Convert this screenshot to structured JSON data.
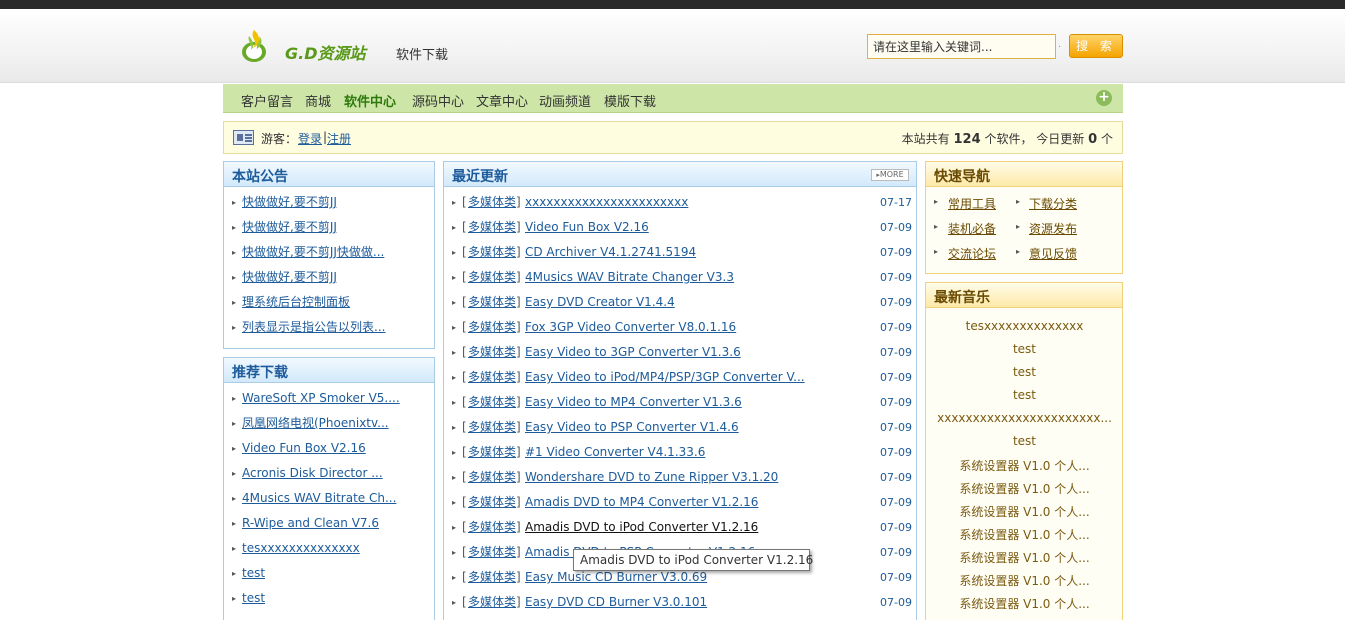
{
  "header": {
    "logo_text": "G.D资源站",
    "logo_sub": "软件下载",
    "search_placeholder": "请在这里输入关键词...",
    "search_button": "搜 索",
    "search_dot": "·"
  },
  "nav": {
    "items": [
      "客户留言",
      "商城",
      "软件中心",
      "源码中心",
      "文章中心",
      "动画频道",
      "模版下载"
    ],
    "active": "软件中心",
    "plus": "+"
  },
  "infobar": {
    "guest_label": "游客：",
    "login": "登录",
    "separator": "|",
    "register": "注册",
    "stats_prefix": "本站共有",
    "software_count": "124",
    "stats_mid": "个软件，  今日更新",
    "today_count": "0",
    "stats_suffix": "个"
  },
  "announcements": {
    "title": "本站公告",
    "items": [
      "快做做好,要不剪JJ",
      "快做做好,要不剪JJ",
      "快做做好,要不剪JJ快做做...",
      "快做做好,要不剪JJ",
      "理系统后台控制面板",
      "列表显示是指公告以列表..."
    ]
  },
  "recommended": {
    "title": "推荐下载",
    "items": [
      "WareSoft XP Smoker V5....",
      "凤凰网络电视(Phoenixtv...",
      "Video Fun Box V2.16",
      "Acronis Disk Director ...",
      "4Musics WAV Bitrate Ch...",
      "R-Wipe and Clean V7.6",
      "tesxxxxxxxxxxxxxx",
      "test",
      "test"
    ]
  },
  "updates": {
    "title": "最近更新",
    "more": "MORE",
    "rows": [
      {
        "cat": "多媒体类",
        "name": "xxxxxxxxxxxxxxxxxxxxxxx",
        "date": "07-17"
      },
      {
        "cat": "多媒体类",
        "name": "Video Fun Box V2.16",
        "date": "07-09"
      },
      {
        "cat": "多媒体类",
        "name": "CD Archiver V4.1.2741.5194",
        "date": "07-09"
      },
      {
        "cat": "多媒体类",
        "name": "4Musics WAV Bitrate Changer V3.3",
        "date": "07-09"
      },
      {
        "cat": "多媒体类",
        "name": "Easy DVD Creator V1.4.4",
        "date": "07-09"
      },
      {
        "cat": "多媒体类",
        "name": "Fox 3GP Video Converter V8.0.1.16",
        "date": "07-09"
      },
      {
        "cat": "多媒体类",
        "name": "Easy Video to 3GP Converter V1.3.6",
        "date": "07-09"
      },
      {
        "cat": "多媒体类",
        "name": "Easy Video to iPod/MP4/PSP/3GP Converter V...",
        "date": "07-09"
      },
      {
        "cat": "多媒体类",
        "name": "Easy Video to MP4 Converter V1.3.6",
        "date": "07-09"
      },
      {
        "cat": "多媒体类",
        "name": "Easy Video to PSP Converter V1.4.6",
        "date": "07-09"
      },
      {
        "cat": "多媒体类",
        "name": "#1 Video Converter V4.1.33.6",
        "date": "07-09"
      },
      {
        "cat": "多媒体类",
        "name": "Wondershare DVD to Zune Ripper V3.1.20",
        "date": "07-09"
      },
      {
        "cat": "多媒体类",
        "name": "Amadis DVD to MP4 Converter V1.2.16",
        "date": "07-09"
      },
      {
        "cat": "多媒体类",
        "name": "Amadis DVD to iPod Converter V1.2.16",
        "date": "07-09"
      },
      {
        "cat": "多媒体类",
        "name": "Amadis DVD to PSP Converter V1.2.16",
        "date": "07-09"
      },
      {
        "cat": "多媒体类",
        "name": "Easy Music CD Burner V3.0.69",
        "date": "07-09"
      },
      {
        "cat": "多媒体类",
        "name": "Easy DVD CD Burner V3.0.101",
        "date": "07-09"
      }
    ]
  },
  "quicknav": {
    "title": "快速导航",
    "links": [
      "常用工具",
      "下载分类",
      "装机必备",
      "资源发布",
      "交流论坛",
      "意见反馈"
    ]
  },
  "music": {
    "title": "最新音乐",
    "items": [
      "tesxxxxxxxxxxxxxx",
      "test",
      "test",
      "test",
      "xxxxxxxxxxxxxxxxxxxxxxx...",
      "test",
      "系统设置器 V1.0 个人...",
      "系统设置器 V1.0 个人...",
      "系统设置器 V1.0 个人...",
      "系统设置器 V1.0 个人...",
      "系统设置器 V1.0 个人...",
      "系统设置器 V1.0 个人...",
      "系统设置器 V1.0 个人..."
    ]
  },
  "tooltip": {
    "text": "Amadis DVD to iPod Converter V1.2.16"
  }
}
